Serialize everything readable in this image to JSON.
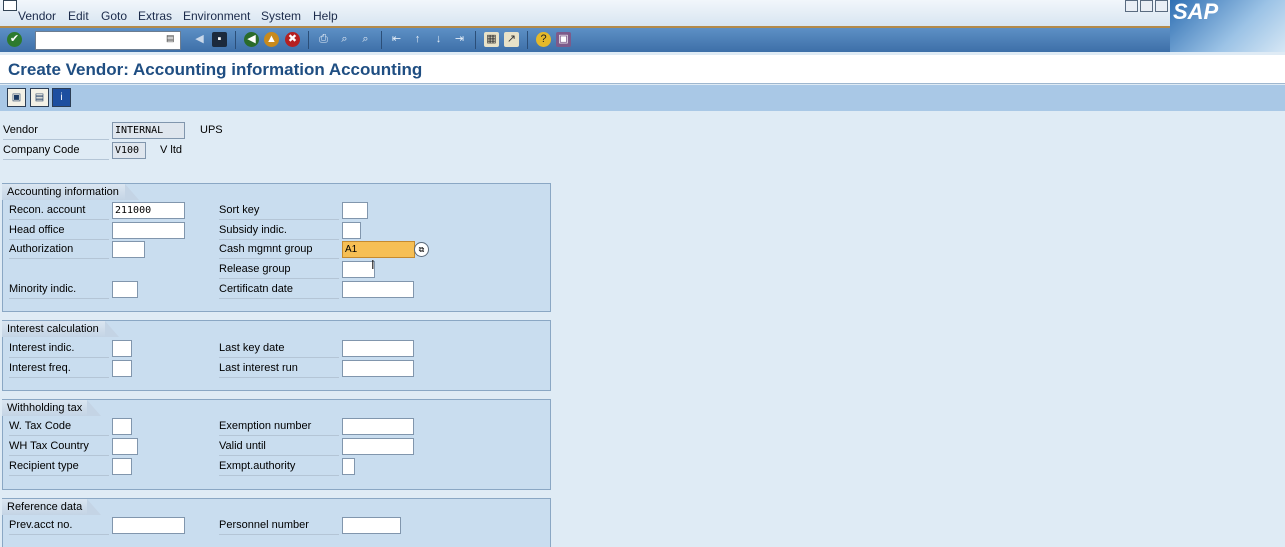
{
  "menu": {
    "items": [
      "Vendor",
      "Edit",
      "Goto",
      "Extras",
      "Environment",
      "System",
      "Help"
    ]
  },
  "sap_logo_text": "SAP",
  "page": {
    "title": "Create Vendor: Accounting information Accounting"
  },
  "header_fields": {
    "vendor_label": "Vendor",
    "vendor_value": "INTERNAL",
    "vendor_name": "UPS",
    "company_code_label": "Company Code",
    "company_code_value": "V100",
    "company_name": "V ltd"
  },
  "accounting_information": {
    "title": "Accounting information",
    "recon_account_label": "Recon. account",
    "recon_account_value": "211000",
    "head_office_label": "Head office",
    "authorization_label": "Authorization",
    "minority_indic_label": "Minority indic.",
    "sort_key_label": "Sort key",
    "subsidy_indic_label": "Subsidy indic.",
    "cash_mgmnt_group_label": "Cash mgmnt group",
    "cash_mgmnt_group_value": "A1",
    "release_group_label": "Release group",
    "certificatn_date_label": "Certificatn date"
  },
  "interest_calculation": {
    "title": "Interest calculation",
    "interest_indic_label": "Interest indic.",
    "interest_freq_label": "Interest freq.",
    "last_key_date_label": "Last key date",
    "last_interest_run_label": "Last interest run"
  },
  "withholding_tax": {
    "title": "Withholding tax",
    "w_tax_code_label": "W. Tax Code",
    "wh_tax_country_label": "WH Tax Country",
    "recipient_type_label": "Recipient type",
    "exemption_number_label": "Exemption number",
    "valid_until_label": "Valid  until",
    "exmpt_authority_label": "Exmpt.authority"
  },
  "reference_data": {
    "title": "Reference data",
    "prev_acct_no_label": "Prev.acct no.",
    "personnel_number_label": "Personnel number"
  },
  "colors": {
    "highlight_field": "#f6bf55",
    "title_text": "#1f4e82",
    "toolbar": "#3d6fa8"
  },
  "icons": [
    "enter-icon",
    "back-icon",
    "save-icon",
    "back-green-icon",
    "exit-icon",
    "cancel-icon",
    "print-icon",
    "find-icon",
    "find-next-icon",
    "first-page-icon",
    "prev-page-icon",
    "next-page-icon",
    "last-page-icon",
    "create-session-icon",
    "shortcut-icon",
    "help-icon",
    "customize-layout-icon"
  ]
}
